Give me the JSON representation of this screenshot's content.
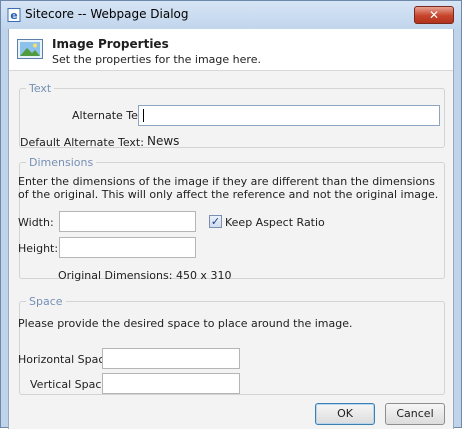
{
  "window": {
    "title": "Sitecore -- Webpage Dialog",
    "close_label": "✕"
  },
  "header": {
    "title": "Image Properties",
    "subtitle": "Set the properties for the image here."
  },
  "text_group": {
    "legend": "Text",
    "alt_label": "Alternate Text:",
    "alt_value": "",
    "default_alt_label": "Default Alternate Text:",
    "default_alt_value": "News"
  },
  "dimensions_group": {
    "legend": "Dimensions",
    "description": "Enter the dimensions of the image if they are different than the dimensions of the original. This will only affect the reference and not the original image.",
    "width_label": "Width:",
    "width_value": "",
    "height_label": "Height:",
    "height_value": "",
    "keep_aspect_label": "Keep Aspect Ratio",
    "keep_aspect_checked": true,
    "original_dimensions": "Original Dimensions: 450 x 310"
  },
  "space_group": {
    "legend": "Space",
    "description": "Please provide the desired space to place around the image.",
    "hspace_label": "Horizontal Space:",
    "hspace_value": "",
    "vspace_label": "Vertical Space:",
    "vspace_value": ""
  },
  "buttons": {
    "ok": "OK",
    "cancel": "Cancel"
  }
}
